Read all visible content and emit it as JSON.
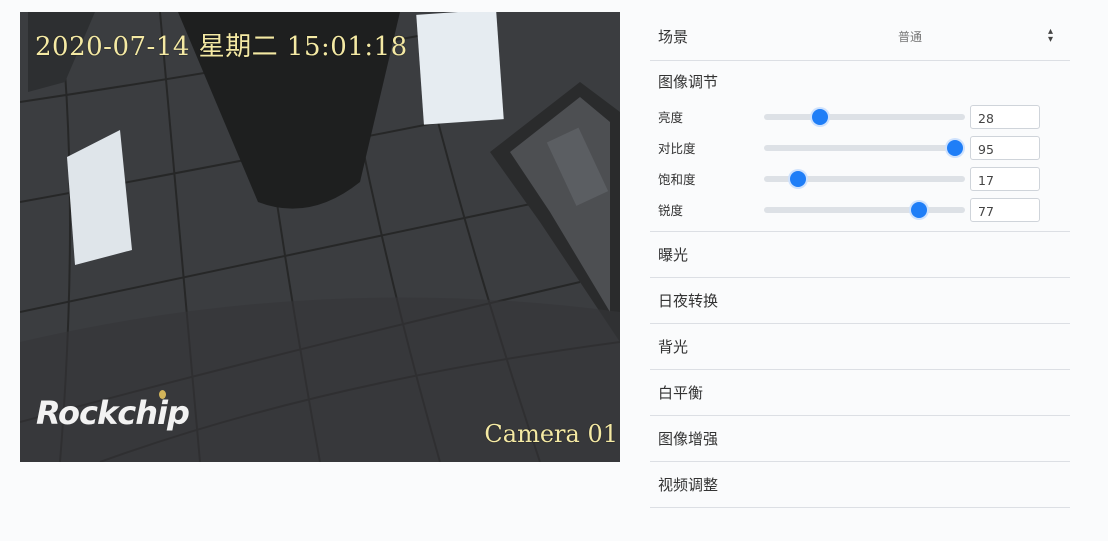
{
  "video": {
    "osd_time": "2020-07-14 星期二 15:01:18",
    "osd_camera": "Camera 01",
    "logo_text": "Rockchip"
  },
  "panel": {
    "scene": {
      "label": "场景",
      "value": "普通"
    },
    "image_adjust": {
      "title": "图像调节",
      "sliders": [
        {
          "label": "亮度",
          "value": "28",
          "level": 0.28
        },
        {
          "label": "对比度",
          "value": "95",
          "level": 0.95
        },
        {
          "label": "饱和度",
          "value": "17",
          "level": 0.17
        },
        {
          "label": "锐度",
          "value": "77",
          "level": 0.77
        }
      ]
    },
    "sections": [
      "曝光",
      "日夜转换",
      "背光",
      "白平衡",
      "图像增强",
      "视频调整"
    ]
  },
  "colors": {
    "accent": "#1f7ef7",
    "osd_text": "#f4e9a4",
    "divider": "#dcdfe4"
  }
}
